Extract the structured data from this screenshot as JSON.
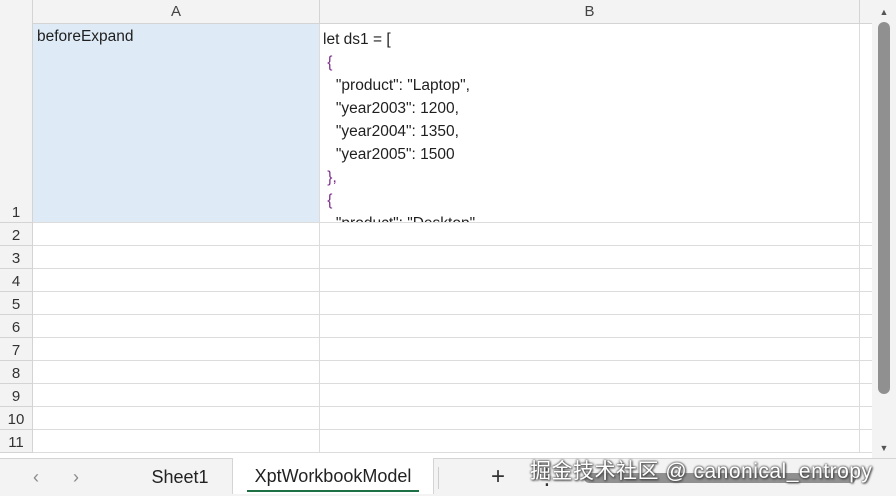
{
  "columns": [
    "A",
    "B"
  ],
  "rows": [
    "1",
    "2",
    "3",
    "4",
    "5",
    "6",
    "7",
    "8",
    "9",
    "10",
    "11"
  ],
  "cells": {
    "A1": "beforeExpand",
    "B1_lines": [
      "let ds1 = [",
      " {",
      "   \"product\": \"Laptop\",",
      "   \"year2003\": 1200,",
      "   \"year2004\": 1350,",
      "   \"year2005\": 1500",
      " },",
      " {",
      "   \"product\": \"Desktop\","
    ]
  },
  "tabs": {
    "prev_icon": "‹",
    "next_icon": "›",
    "sheet1": "Sheet1",
    "active": "XptWorkbookModel",
    "add": "+",
    "more": "⋮"
  },
  "watermark": "掘金技术社区 @ canonical_entropy",
  "colors": {
    "selected_cell": "#deeaf5",
    "active_tab_underline": "#1e7145",
    "header_bg": "#f3f3f3"
  }
}
